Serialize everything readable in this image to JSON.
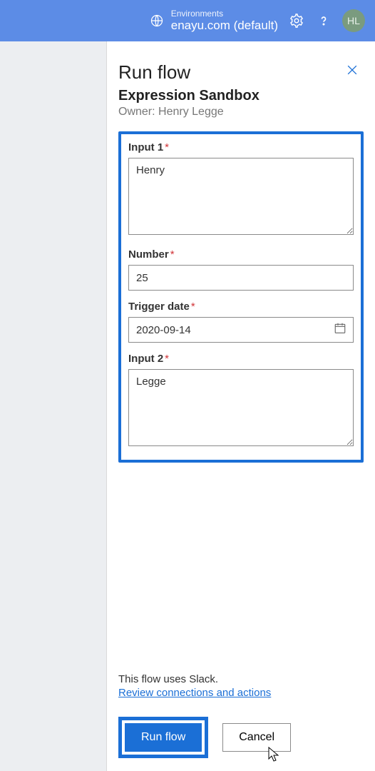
{
  "topbar": {
    "env_label": "Environments",
    "env_name": "enayu.com (default)",
    "avatar_initials": "HL"
  },
  "panel": {
    "title": "Run flow",
    "subtitle": "Expression Sandbox",
    "owner_line": "Owner: Henry Legge"
  },
  "fields": {
    "input1": {
      "label": "Input 1",
      "value": "Henry"
    },
    "number": {
      "label": "Number",
      "value": "25"
    },
    "trigger_date": {
      "label": "Trigger date",
      "value": "2020-09-14"
    },
    "input2": {
      "label": "Input 2",
      "value": "Legge"
    }
  },
  "footer": {
    "info_text": "This flow uses Slack.",
    "link_text": "Review connections and actions",
    "run_label": "Run flow",
    "cancel_label": "Cancel"
  }
}
